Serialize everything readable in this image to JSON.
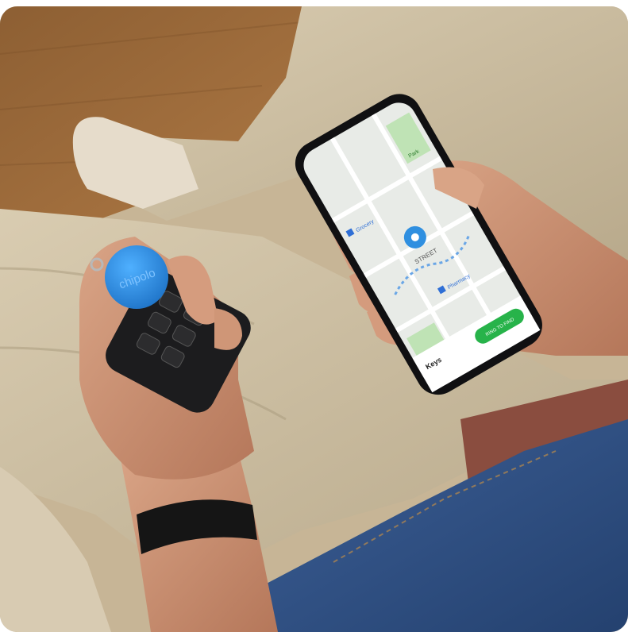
{
  "photo": {
    "colors": {
      "floor": "#9a6a3a",
      "pants": "#cbbd9f",
      "skin": "#c98f6e",
      "tracker": "#2f8fe0",
      "key_fob": "#1c1c1e",
      "watch": "#151515",
      "jeans": "#2f4f82",
      "shirt": "#8a4d3f",
      "phone_frame": "#101012",
      "map_bg": "#e8ebe7",
      "app_button": "#27b34a"
    },
    "tracker_brand": "chipolo",
    "phone_map": {
      "street_label": "STREET",
      "place_labels": [
        "Grocery",
        "Pharmacy",
        "Park"
      ],
      "item_name": "Keys",
      "action_button": "RING TO FIND"
    }
  }
}
